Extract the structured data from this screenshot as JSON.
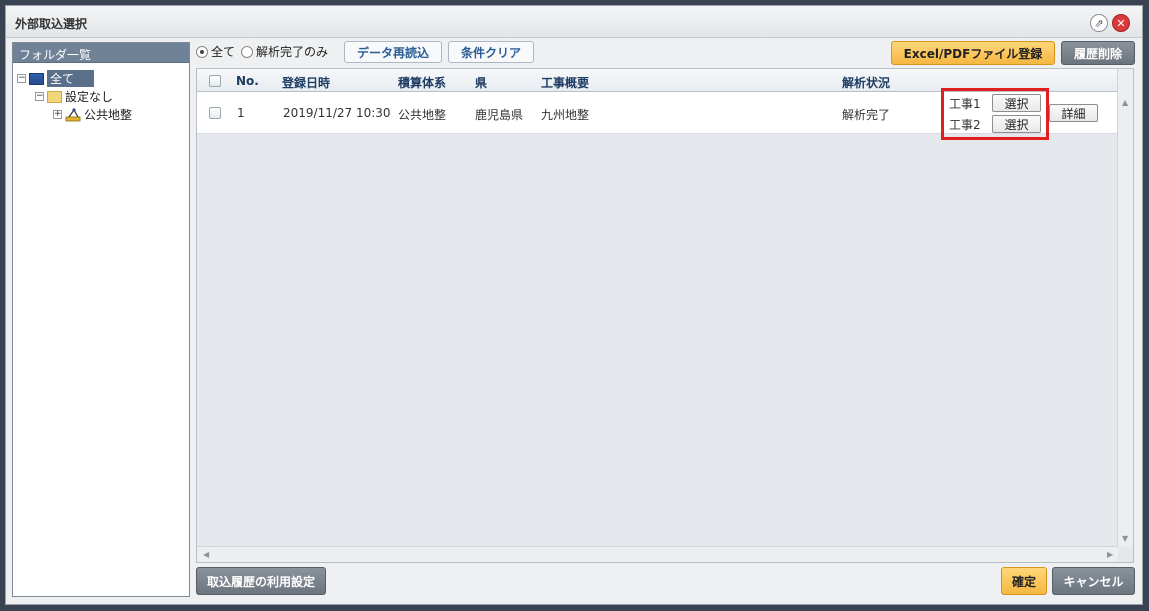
{
  "window": {
    "title": "外部取込選択"
  },
  "left_panel": {
    "header": "フォルダ一覧",
    "tree": [
      {
        "label": "全て",
        "toggle": "−",
        "icon": "computer-icon",
        "selected": true
      },
      {
        "label": "設定なし",
        "toggle": "−",
        "icon": "folder-icon"
      },
      {
        "label": "公共地整",
        "toggle": "+",
        "icon": "survey-icon"
      }
    ]
  },
  "filters": {
    "radio_all": "全て",
    "radio_done": "解析完了のみ",
    "reload": "データ再読込",
    "clear": "条件クリア"
  },
  "actions": {
    "register": "Excel/PDFファイル登録",
    "delete_history": "履歴削除"
  },
  "table": {
    "columns": [
      "No.",
      "登録日時",
      "積算体系",
      "県",
      "工事概要",
      "解析状況"
    ],
    "rows": [
      {
        "no": "1",
        "date": "2019/11/27 10:30",
        "system": "公共地整",
        "pref": "鹿児島県",
        "summary": "九州地整",
        "status": "解析完了",
        "works": [
          {
            "label": "工事1",
            "button": "選択"
          },
          {
            "label": "工事2",
            "button": "選択"
          }
        ],
        "detail": "詳細"
      }
    ]
  },
  "footer": {
    "history_settings": "取込履歴の利用設定",
    "confirm": "確定",
    "cancel": "キャンセル"
  }
}
